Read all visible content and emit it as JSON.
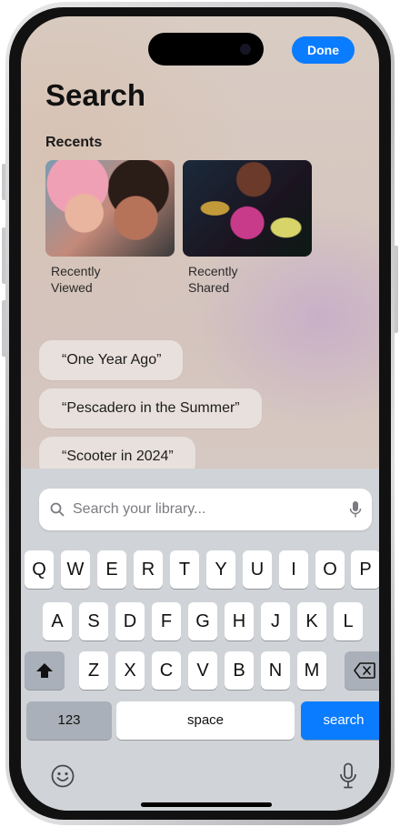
{
  "header": {
    "done_label": "Done",
    "title": "Search"
  },
  "recents": {
    "heading": "Recents",
    "tiles": [
      {
        "line1": "Recently",
        "line2": "Viewed"
      },
      {
        "line1": "Recently",
        "line2": "Shared"
      }
    ]
  },
  "suggestions": [
    "“One Year Ago”",
    "“Pescadero in the Summer”",
    "“Scooter in 2024”"
  ],
  "search": {
    "placeholder": "Search your library..."
  },
  "keyboard": {
    "row1": [
      "Q",
      "W",
      "E",
      "R",
      "T",
      "Y",
      "U",
      "I",
      "O",
      "P"
    ],
    "row2": [
      "A",
      "S",
      "D",
      "F",
      "G",
      "H",
      "J",
      "K",
      "L"
    ],
    "row3": [
      "Z",
      "X",
      "C",
      "V",
      "B",
      "N",
      "M"
    ],
    "numbers_label": "123",
    "space_label": "space",
    "search_label": "search"
  },
  "icons": {
    "shift": "shift-icon",
    "delete": "delete-icon",
    "emoji": "emoji-icon",
    "dictation": "microphone-icon",
    "search": "search-icon"
  },
  "colors": {
    "accent": "#0a7cff"
  }
}
